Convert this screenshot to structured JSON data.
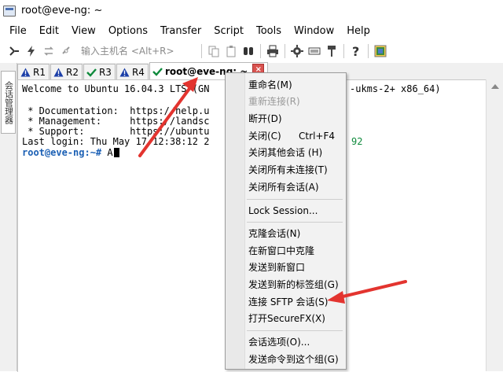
{
  "window": {
    "title": "root@eve-ng: ~"
  },
  "menubar": [
    "File",
    "Edit",
    "View",
    "Options",
    "Transfer",
    "Script",
    "Tools",
    "Window",
    "Help"
  ],
  "toolbar": {
    "quick_connect_placeholder": "输入主机名 <Alt+R>"
  },
  "tabs": [
    {
      "label": "R1",
      "icon": "warning-icon"
    },
    {
      "label": "R2",
      "icon": "warning-icon"
    },
    {
      "label": "R3",
      "icon": "check-icon"
    },
    {
      "label": "R4",
      "icon": "warning-icon"
    },
    {
      "label": "root@eve-ng: ~",
      "icon": "check-icon",
      "active": true
    }
  ],
  "sidepanel": {
    "tab_label": "会话管理器"
  },
  "terminal": {
    "lines": [
      "Welcome to Ubuntu 16.04.3 LTS (GN",
      "",
      " * Documentation:  https://help.u",
      " * Management:     https://landsc",
      " * Support:        https://ubuntu",
      "Last login: Thu May 17 12:38:12 2",
      ""
    ],
    "line0_tail": "-ukms-2+ x86_64)",
    "line5_tail": "92",
    "prompt": "root@eve-ng:~#",
    "typed": " A"
  },
  "context_menu": {
    "items": [
      {
        "label": "重命名(M)"
      },
      {
        "label": "重新连接(R)",
        "disabled": true
      },
      {
        "label": "断开(D)"
      },
      {
        "label": "关闭(C)",
        "shortcut": "Ctrl+F4"
      },
      {
        "label": "关闭其他会话 (H)"
      },
      {
        "label": "关闭所有未连接(T)"
      },
      {
        "label": "关闭所有会话(A)"
      },
      {
        "label": "Lock Session..."
      },
      {
        "label": "克隆会话(N)"
      },
      {
        "label": "在新窗口中克隆"
      },
      {
        "label": "发送到新窗口"
      },
      {
        "label": "发送到新的标签组(G)"
      },
      {
        "label": "连接 SFTP 会话(S)"
      },
      {
        "label": "打开SecureFX(X)"
      },
      {
        "label": "会话选项(O)..."
      },
      {
        "label": "发送命令到这个组(G)"
      }
    ]
  },
  "colors": {
    "arrow": "#e3342f",
    "prompt": "#1a5fb4",
    "ok": "#0f8a3c",
    "close": "#d9534f"
  }
}
